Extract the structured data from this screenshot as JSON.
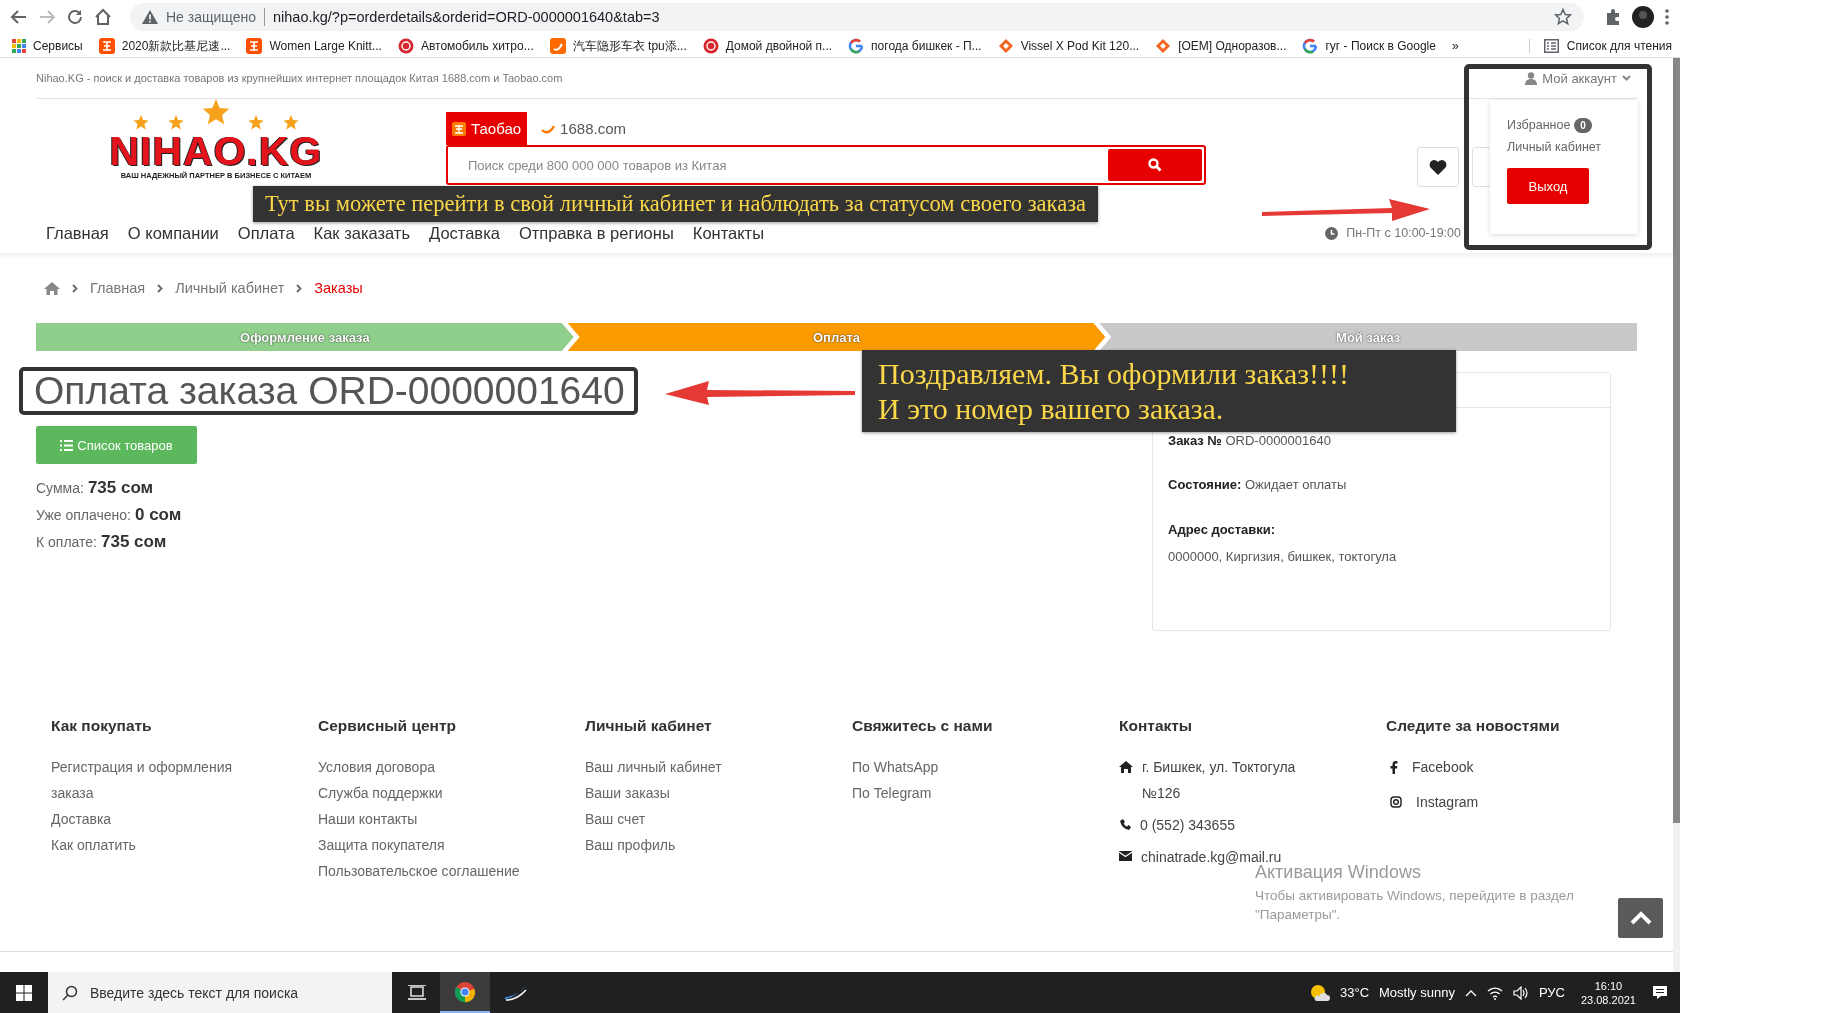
{
  "browser": {
    "address": {
      "security": "Не защищено",
      "url": "nihao.kg/?p=orderdetails&orderid=ORD-0000001640&tab=3"
    },
    "bookmarks": [
      {
        "label": "Сервисы",
        "kind": "apps"
      },
      {
        "label": "2020新款比基尼速...",
        "kind": "taobao"
      },
      {
        "label": "Women Large Knitt...",
        "kind": "taobao"
      },
      {
        "label": "Автомобиль хитро...",
        "kind": "badge"
      },
      {
        "label": "汽车隐形车衣 tpu添...",
        "kind": "alibaba"
      },
      {
        "label": "Домой двойной п...",
        "kind": "badge"
      },
      {
        "label": "погода бишкек - П...",
        "kind": "google"
      },
      {
        "label": "Vissel X Pod Kit 120...",
        "kind": "diamond"
      },
      {
        "label": "[OEM] Одноразов...",
        "kind": "diamond"
      },
      {
        "label": "гуг - Поиск в Google",
        "kind": "google"
      }
    ],
    "overflow": "»",
    "reading_list": "Список для чтения"
  },
  "site": {
    "tagline": "Nihao.KG - поиск и доставка товаров из крупнейших интернет площадок Китая 1688.com и Taobao.com",
    "account": "Мой аккаунт",
    "logo": {
      "name": "NIHAO.KG",
      "slogan": "ВАШ НАДЕЖНЫЙ ПАРТНЕР В БИЗНЕСЕ С КИТАЕМ"
    },
    "search_tabs": [
      {
        "label": "Таобао",
        "selected": true
      },
      {
        "label": "1688.com",
        "selected": false
      }
    ],
    "search": {
      "placeholder": "Поиск среди 800 000 000 товаров из Китая"
    },
    "nav": [
      "Главная",
      "О компании",
      "Оплата",
      "Как заказать",
      "Доставка",
      "Отправка в регионы",
      "Контакты"
    ],
    "hours": "Пн-Пт с 10:00-19:00",
    "account_menu": {
      "favorites": "Избранное",
      "favorites_count": "0",
      "cabinet": "Личный кабинет",
      "logout": "Выход"
    }
  },
  "breadcrumbs": [
    "Главная",
    "Личный кабинет",
    "Заказы"
  ],
  "steps": [
    {
      "label": "Оформление заказа",
      "color": "#8fcf8b"
    },
    {
      "label": "Оплата",
      "color": "#fb9b00"
    },
    {
      "label": "Мой заказ",
      "color": "#c8c8c8"
    }
  ],
  "order": {
    "title": "Оплата заказа ORD-0000001640",
    "list_button": "Список товаров",
    "totals": [
      {
        "label": "Сумма:",
        "value": "735 сом"
      },
      {
        "label": "Уже оплачено:",
        "value": "0 сом"
      },
      {
        "label": "К оплате:",
        "value": "735 сом"
      }
    ]
  },
  "info": [
    {
      "label": "Заказ №",
      "value": "ORD-0000001640"
    },
    {
      "label": "Состояние:",
      "value": "Ожидает оплаты"
    },
    {
      "label": "Адрес доставки:",
      "value": "0000000, Киргизия, бишкек, токтогула"
    }
  ],
  "footer": [
    {
      "title": "Как покупать",
      "items": [
        {
          "label": "Регистрация и оформления заказа"
        },
        {
          "label": "Доставка"
        },
        {
          "label": "Как оплатить"
        }
      ]
    },
    {
      "title": "Сервисный центр",
      "items": [
        {
          "label": "Условия договора"
        },
        {
          "label": "Служба поддержки"
        },
        {
          "label": "Наши контакты"
        },
        {
          "label": "Защита покупателя"
        },
        {
          "label": "Пользовательское соглашение"
        }
      ]
    },
    {
      "title": "Личный кабинет",
      "items": [
        {
          "label": "Ваш личный кабинет"
        },
        {
          "label": "Ваши заказы"
        },
        {
          "label": "Ваш счет"
        },
        {
          "label": "Ваш профиль"
        }
      ]
    },
    {
      "title": "Свяжитесь с нами",
      "items": [
        {
          "label": "По WhatsApp"
        },
        {
          "label": "По Telegram"
        }
      ]
    },
    {
      "title": "Контакты",
      "items": [
        {
          "label": "г. Бишкек, ул. Токтогула №126",
          "kind": "address"
        },
        {
          "label": "0 (552) 343655",
          "kind": "phone"
        },
        {
          "label": "chinatrade.kg@mail.ru",
          "kind": "email"
        }
      ]
    },
    {
      "title": "Следите за новостями",
      "items": [
        {
          "label": "Facebook",
          "kind": "facebook"
        },
        {
          "label": "Instagram",
          "kind": "instagram"
        }
      ]
    }
  ],
  "annotations": [
    {
      "text": "Тут вы можете перейти в свой личный кабинет и наблюдать за статусом своего заказа"
    },
    {
      "text": "Поздравляем. Вы оформили заказ!!!!\nИ это номер вашего заказа."
    }
  ],
  "windows_notice": {
    "title": "Активация Windows",
    "text": "Чтобы активировать Windows, перейдите в раздел \"Параметры\"."
  },
  "taskbar": {
    "search_placeholder": "Введите здесь текст для поиска",
    "apps": [
      {
        "kind": "chrome",
        "selected": true
      },
      {
        "kind": "app",
        "selected": false
      }
    ],
    "temperature": "33°C",
    "weather": "Mostly sunny",
    "language": "РУС",
    "time": "16:10",
    "date": "23.08.2021"
  }
}
